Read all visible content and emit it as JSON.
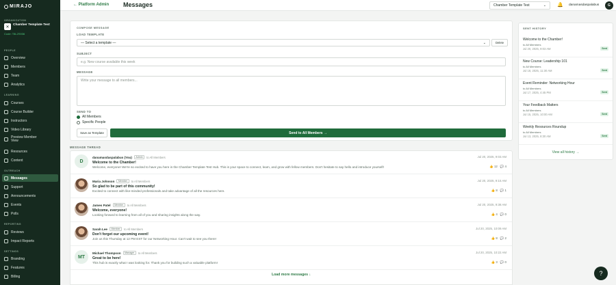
{
  "sidebar": {
    "brand": "MIRAJO",
    "org_label": "ORGANIZATION",
    "org_name": "Chamber Template Test",
    "org_code": "Code: T8L2S936",
    "sections": {
      "people": "PEOPLE",
      "learning": "LEARNING",
      "outreach": "OUTREACH",
      "reporting": "REPORTING",
      "settings": "SETTINGS"
    },
    "items": {
      "overview": "Overview",
      "members": "Members",
      "team": "Team",
      "analytics": "Analytics",
      "courses": "Courses",
      "course_builder": "Course Builder",
      "instructors": "Instructors",
      "video_library": "Video Library",
      "preview_member_view": "Preview Member View",
      "resources": "Resources",
      "content": "Content",
      "messages": "Messages",
      "support": "Support",
      "announcements": "Announcements",
      "events": "Events",
      "polls": "Polls",
      "reviews": "Reviews",
      "impact_reports": "Impact Reports",
      "branding": "Branding",
      "features": "Features",
      "billing": "Billing"
    }
  },
  "topbar": {
    "back_label": "← Platform Admin",
    "title": "Messages",
    "org_select": "Chamber Template Test",
    "user_name": "danamasdaspalabus",
    "user_initial": "G"
  },
  "compose": {
    "heading": "COMPOSE MESSAGE",
    "load_template_label": "LOAD TEMPLATE",
    "template_select": "— Select a template —",
    "delete_label": "Delete",
    "subject_label": "SUBJECT",
    "subject_placeholder": "e.g. New course available this week",
    "message_label": "MESSAGE",
    "message_placeholder": "Write your message to all members...",
    "send_to_label": "SEND TO",
    "option_all": "All Members",
    "option_specific": "Specific People",
    "save_template_label": "Save as Template",
    "send_label": "Send to All Members →"
  },
  "thread": {
    "label": "MESSAGE THREAD",
    "load_more": "Load more messages ↓",
    "messages": [
      {
        "initials": "D",
        "avatar": "initial",
        "author": "danamasdaspalabus (You)",
        "badge": "Admin",
        "to": "to All Members",
        "subject": "Welcome to the Chamber!",
        "body": "Welcome, everyone! We're so excited to have you here in the Chamber Template Test Hub. This is your space to connect, learn, and grow with fellow members. Don't hesitate to say hello and introduce yourself!",
        "date": "Jul 20, 2025, 9:03 AM",
        "likes": "12",
        "replies": "4"
      },
      {
        "initials": "",
        "avatar": "photo",
        "author": "Maria Johnson",
        "badge": "Member",
        "to": "to All Members",
        "subject": "So glad to be part of this community!",
        "body": "Excited to connect with like-minded professionals and take advantage of all the resources here.",
        "date": "Jul 20, 2025, 9:15 AM",
        "likes": "8",
        "replies": "1"
      },
      {
        "initials": "",
        "avatar": "photo",
        "author": "James Patel",
        "badge": "Member",
        "to": "to All Members",
        "subject": "Welcome, everyone!",
        "body": "Looking forward to learning from all of you and sharing insights along the way.",
        "date": "Jul 20, 2025, 9:38 AM",
        "likes": "4",
        "replies": "0"
      },
      {
        "initials": "",
        "avatar": "photo",
        "author": "Sarah Lee",
        "badge": "Member",
        "to": "to All Members",
        "subject": "Don't forget our upcoming event!",
        "body": "Join us this Thursday at 12 PM EST for our Networking Hour. Can't wait to see you there!",
        "date": "Jul 20, 2025, 10:09 AM",
        "likes": "8",
        "replies": "2"
      },
      {
        "initials": "MT",
        "avatar": "initial",
        "author": "Michael Thompson",
        "badge": "Manager",
        "to": "to All Members",
        "subject": "Great to be here!",
        "body": "This hub is exactly what I was looking for. Thank you for building such a valuable platform!",
        "date": "Jul 20, 2025, 10:22 AM",
        "likes": "3",
        "replies": "0"
      }
    ]
  },
  "history": {
    "heading": "SENT HISTORY",
    "view_all": "View all history →",
    "items": [
      {
        "title": "Welcome to the Chamber!",
        "to": "to All Members",
        "date": "Jul 20, 2025, 9:03 AM",
        "status": "Sent"
      },
      {
        "title": "New Course: Leadership 101",
        "to": "to All Members",
        "date": "Jul 18, 2025, 11:30 AM",
        "status": "Sent"
      },
      {
        "title": "Event Reminder: Networking Hour",
        "to": "to All Members",
        "date": "Jul 17, 2025, 4:45 PM",
        "status": "Sent"
      },
      {
        "title": "Your Feedback Matters",
        "to": "to All Members",
        "date": "Jul 15, 2025, 10:00 AM",
        "status": "Sent"
      },
      {
        "title": "Weekly Resources Roundup",
        "to": "to All Members",
        "date": "Jul 13, 2025, 8:30 AM",
        "status": "Sent"
      }
    ]
  },
  "icons": {
    "help": "question-icon",
    "notification": "bell-icon"
  },
  "colors": {
    "sidebar_bg": "#162a1f",
    "accent": "#1f6b3b",
    "active_nav": "#2f5a3f"
  }
}
